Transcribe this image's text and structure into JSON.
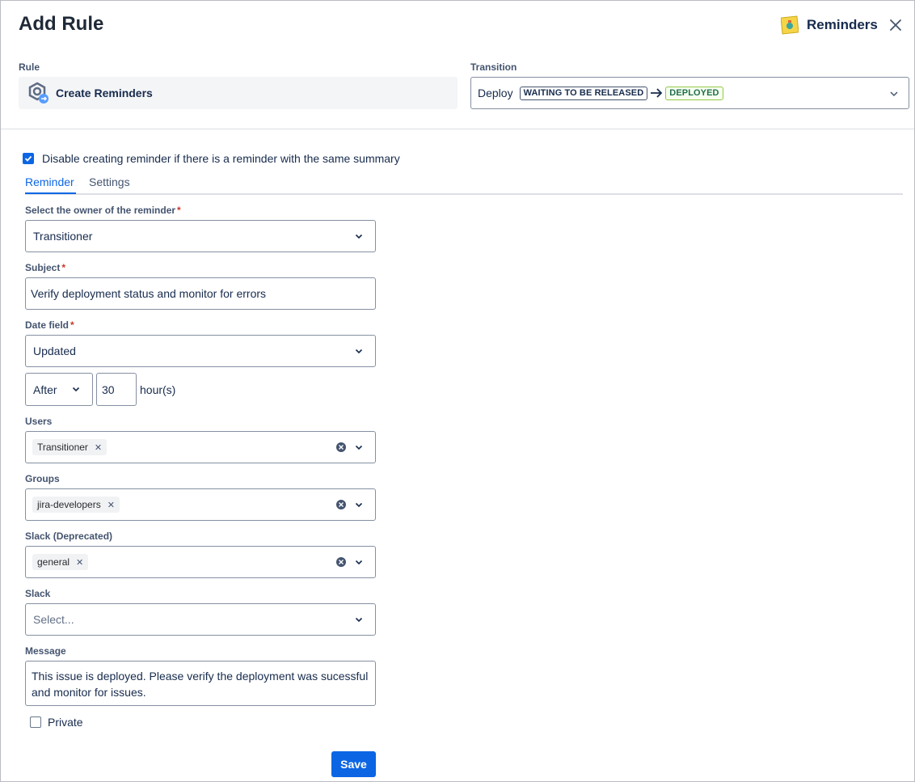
{
  "header": {
    "title": "Add Rule",
    "app_name": "Reminders"
  },
  "rule": {
    "label": "Rule",
    "value": "Create Reminders"
  },
  "transition": {
    "label": "Transition",
    "name": "Deploy",
    "from_status": "WAITING TO BE RELEASED",
    "to_status": "DEPLOYED"
  },
  "options": {
    "disable_duplicate_label": "Disable creating reminder if there is a reminder with the same summary",
    "disable_duplicate_checked": true
  },
  "tabs": [
    {
      "label": "Reminder",
      "active": true
    },
    {
      "label": "Settings",
      "active": false
    }
  ],
  "form": {
    "owner": {
      "label": "Select the owner of the reminder",
      "required_mark": "*",
      "value": "Transitioner"
    },
    "subject": {
      "label": "Subject",
      "required_mark": "*",
      "value": "Verify deployment status and monitor for errors"
    },
    "date_field": {
      "label": "Date field",
      "required_mark": "*",
      "value": "Updated"
    },
    "offset": {
      "direction": "After",
      "amount": "30",
      "unit": "hour(s)"
    },
    "users": {
      "label": "Users",
      "tags": [
        "Transitioner"
      ]
    },
    "groups": {
      "label": "Groups",
      "tags": [
        "jira-developers"
      ]
    },
    "slack_deprecated": {
      "label": "Slack (Deprecated)",
      "tags": [
        "general"
      ]
    },
    "slack": {
      "label": "Slack",
      "placeholder": "Select..."
    },
    "message": {
      "label": "Message",
      "value": "This issue is deployed. Please verify the deployment was sucessful and monitor for issues."
    },
    "private": {
      "label": "Private",
      "checked": false
    }
  },
  "actions": {
    "save_label": "Save"
  },
  "colors": {
    "primary": "#0c66e4",
    "required": "#c9372c",
    "border": "#8590a2"
  }
}
